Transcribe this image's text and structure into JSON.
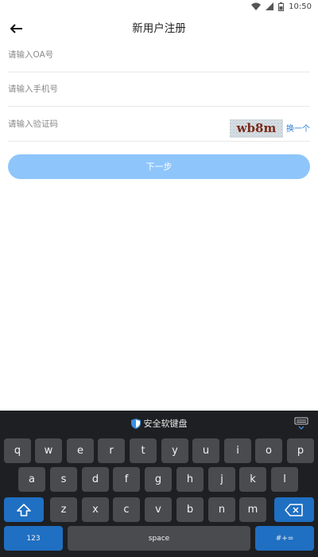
{
  "status_bar": {
    "time": "10:50"
  },
  "header": {
    "title": "新用户注册"
  },
  "form": {
    "oa_placeholder": "请输入OA号",
    "phone_placeholder": "请输入手机号",
    "code_placeholder": "请输入验证码",
    "captcha_text": "wb8m",
    "refresh_label": "换一个"
  },
  "next_button": {
    "label": "下一步"
  },
  "keyboard": {
    "title": "安全软键盘",
    "row1": [
      "q",
      "w",
      "e",
      "r",
      "t",
      "y",
      "u",
      "i",
      "o",
      "p"
    ],
    "row2": [
      "a",
      "s",
      "d",
      "f",
      "g",
      "h",
      "j",
      "k",
      "l"
    ],
    "row3": [
      "z",
      "x",
      "c",
      "v",
      "b",
      "n",
      "m"
    ],
    "num_label": "123",
    "space_label": "space",
    "symbol_label": "#+="
  },
  "colors": {
    "accent": "#8ec5fb",
    "link": "#2a7ed8",
    "key_blue": "#1f6fc2",
    "keyboard_bg": "#1e1f22",
    "key_bg": "#4a4b4f"
  }
}
